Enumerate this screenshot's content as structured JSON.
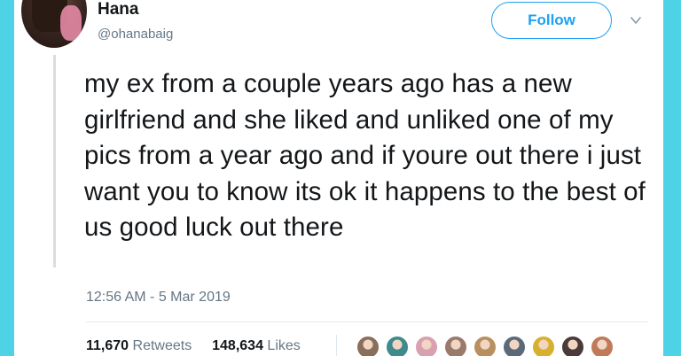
{
  "tweet": {
    "author_name": "Hana",
    "author_handle": "@ohanabaig",
    "follow_label": "Follow",
    "text": "my ex from a couple years ago has a new girlfriend and she liked and unliked one of my pics from a year ago and if youre out there i just want you to know its ok it happens to the best of us good luck out there",
    "timestamp": "12:56 AM - 5 Mar 2019"
  },
  "stats": {
    "retweets_count": "11,670",
    "retweets_label": "Retweets",
    "likes_count": "148,634",
    "likes_label": "Likes"
  },
  "likers": [
    {
      "icon": "liker-avatar",
      "color": "#8a6e5c"
    },
    {
      "icon": "liker-avatar",
      "color": "#3e8a8c"
    },
    {
      "icon": "liker-avatar",
      "color": "#d9a0b0"
    },
    {
      "icon": "liker-avatar",
      "color": "#9a7a6a"
    },
    {
      "icon": "liker-avatar",
      "color": "#b89060"
    },
    {
      "icon": "liker-avatar",
      "color": "#5a6a78"
    },
    {
      "icon": "liker-avatar",
      "color": "#d8b030"
    },
    {
      "icon": "liker-avatar",
      "color": "#4a3a3a"
    },
    {
      "icon": "liker-avatar",
      "color": "#c07a5a"
    }
  ],
  "colors": {
    "accent": "#1da1f2",
    "background": "#4dd2e6",
    "secondary_text": "#657786"
  }
}
